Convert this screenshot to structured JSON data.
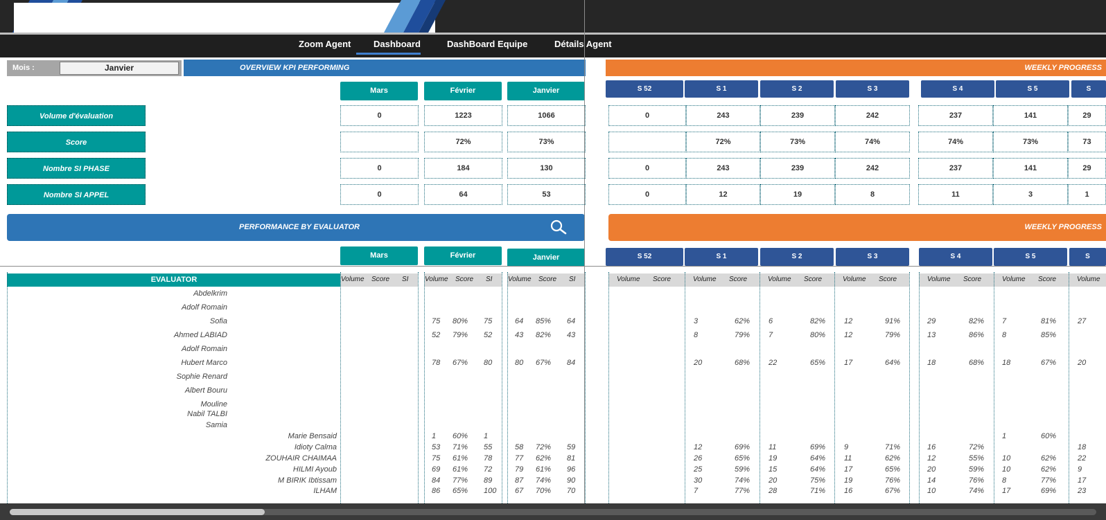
{
  "nav": {
    "items": [
      "Zoom Agent",
      "Dashboard",
      "DashBoard Equipe",
      "Détails Agent"
    ],
    "active": "Dashboard"
  },
  "filter": {
    "label": "Mois :",
    "value": "Janvier"
  },
  "overview": {
    "title": "OVERVIEW KPI PERFORMING",
    "months": [
      "Mars",
      "Février",
      "Janvier"
    ],
    "kpis": [
      {
        "label": "Volume d'évaluation",
        "values": [
          "0",
          "1223",
          "1066"
        ]
      },
      {
        "label": "Score",
        "values": [
          "",
          "72%",
          "73%"
        ]
      },
      {
        "label": "Nombre SI PHASE",
        "values": [
          "0",
          "184",
          "130"
        ]
      },
      {
        "label": "Nombre SI APPEL",
        "values": [
          "0",
          "64",
          "53"
        ]
      }
    ]
  },
  "weekly": {
    "title": "WEEKLY PROGRESS",
    "weeks": [
      "S 52",
      "S 1",
      "S 2",
      "S 3",
      "S 4",
      "S 5",
      "S"
    ],
    "kpis": [
      [
        "0",
        "243",
        "239",
        "242",
        "237",
        "141",
        "29"
      ],
      [
        "",
        "72%",
        "73%",
        "74%",
        "74%",
        "73%",
        "73"
      ],
      [
        "0",
        "243",
        "239",
        "242",
        "237",
        "141",
        "29"
      ],
      [
        "0",
        "12",
        "19",
        "8",
        "11",
        "3",
        "1"
      ]
    ]
  },
  "performance": {
    "title": "PERFORMANCE  BY EVALUATOR",
    "weekly_title": "WEEKLY PROGRESS",
    "evaluator_header": "EVALUATOR",
    "month_subcols": [
      "Volume",
      "Score",
      "SI"
    ],
    "week_subcols": [
      "Volume",
      "Score"
    ],
    "rows": [
      {
        "name": "Abdelkrim",
        "m": [
          "",
          "",
          "",
          "",
          "",
          "",
          "",
          "",
          ""
        ],
        "w": [
          "",
          "",
          "",
          "",
          "",
          "",
          "",
          "",
          "",
          "",
          "",
          "",
          ""
        ]
      },
      {
        "name": "Adolf Romain",
        "m": [
          "",
          "",
          "",
          "",
          "",
          "",
          "",
          "",
          ""
        ],
        "w": [
          "",
          "",
          "",
          "",
          "",
          "",
          "",
          "",
          "",
          "",
          "",
          "",
          ""
        ]
      },
      {
        "name": "Sofia",
        "m": [
          "",
          "",
          "",
          "75",
          "80%",
          "75",
          "64",
          "85%",
          "64"
        ],
        "w": [
          "",
          "",
          "3",
          "62%",
          "6",
          "82%",
          "12",
          "91%",
          "29",
          "82%",
          "7",
          "81%",
          "27"
        ]
      },
      {
        "name": "Ahmed LABIAD",
        "m": [
          "",
          "",
          "",
          "52",
          "79%",
          "52",
          "43",
          "82%",
          "43"
        ],
        "w": [
          "",
          "",
          "8",
          "79%",
          "7",
          "80%",
          "12",
          "79%",
          "13",
          "86%",
          "8",
          "85%",
          ""
        ]
      },
      {
        "name": "Adolf Romain",
        "m": [
          "",
          "",
          "",
          "",
          "",
          "",
          "",
          "",
          ""
        ],
        "w": [
          "",
          "",
          "",
          "",
          "",
          "",
          "",
          "",
          "",
          "",
          "",
          "",
          ""
        ]
      },
      {
        "name": "Hubert Marco",
        "m": [
          "",
          "",
          "",
          "78",
          "67%",
          "80",
          "80",
          "67%",
          "84"
        ],
        "w": [
          "",
          "",
          "20",
          "68%",
          "22",
          "65%",
          "17",
          "64%",
          "18",
          "68%",
          "18",
          "67%",
          "20"
        ]
      },
      {
        "name": "Sophie Renard",
        "m": [
          "",
          "",
          "",
          "",
          "",
          "",
          "",
          "",
          ""
        ],
        "w": [
          "",
          "",
          "",
          "",
          "",
          "",
          "",
          "",
          "",
          "",
          "",
          "",
          ""
        ]
      },
      {
        "name": "Albert Bouru",
        "m": [
          "",
          "",
          "",
          "",
          "",
          "",
          "",
          "",
          ""
        ],
        "w": [
          "",
          "",
          "",
          "",
          "",
          "",
          "",
          "",
          "",
          "",
          "",
          "",
          ""
        ]
      },
      {
        "name": "Mouline",
        "m": [
          "",
          "",
          "",
          "",
          "",
          "",
          "",
          "",
          ""
        ],
        "w": [
          "",
          "",
          "",
          "",
          "",
          "",
          "",
          "",
          "",
          "",
          "",
          "",
          ""
        ]
      },
      {
        "name": "Nabil TALBI",
        "m": [
          "",
          "",
          "",
          "",
          "",
          "",
          "",
          "",
          ""
        ],
        "w": [
          "",
          "",
          "",
          "",
          "",
          "",
          "",
          "",
          "",
          "",
          "",
          "",
          ""
        ]
      },
      {
        "name": "Samia",
        "m": [
          "",
          "",
          "",
          "",
          "",
          "",
          "",
          "",
          ""
        ],
        "w": [
          "",
          "",
          "",
          "",
          "",
          "",
          "",
          "",
          "",
          "",
          "",
          "",
          ""
        ]
      },
      {
        "name": "Marie Bensaid",
        "m": [
          "",
          "",
          "",
          "1",
          "60%",
          "1",
          "",
          "",
          ""
        ],
        "w": [
          "",
          "",
          "",
          "",
          "",
          "",
          "",
          "",
          "",
          "",
          "1",
          "60%",
          ""
        ]
      },
      {
        "name": "Idioty Calma",
        "m": [
          "",
          "",
          "",
          "53",
          "71%",
          "55",
          "58",
          "72%",
          "59"
        ],
        "w": [
          "",
          "",
          "12",
          "69%",
          "11",
          "69%",
          "9",
          "71%",
          "16",
          "72%",
          "",
          "",
          "18"
        ]
      },
      {
        "name": "ZOUHAIR CHAIMAA",
        "m": [
          "",
          "",
          "",
          "75",
          "61%",
          "78",
          "77",
          "62%",
          "81"
        ],
        "w": [
          "",
          "",
          "26",
          "65%",
          "19",
          "64%",
          "11",
          "62%",
          "12",
          "55%",
          "10",
          "62%",
          "22"
        ]
      },
      {
        "name": "HILMI Ayoub",
        "m": [
          "",
          "",
          "",
          "69",
          "61%",
          "72",
          "79",
          "61%",
          "96"
        ],
        "w": [
          "",
          "",
          "25",
          "59%",
          "15",
          "64%",
          "17",
          "65%",
          "20",
          "59%",
          "10",
          "62%",
          "9"
        ]
      },
      {
        "name": "M BIRIK Ibtissam",
        "m": [
          "",
          "",
          "",
          "84",
          "77%",
          "89",
          "87",
          "74%",
          "90"
        ],
        "w": [
          "",
          "",
          "30",
          "74%",
          "20",
          "75%",
          "19",
          "76%",
          "14",
          "76%",
          "8",
          "77%",
          "17"
        ]
      },
      {
        "name": "ILHAM",
        "m": [
          "",
          "",
          "",
          "86",
          "65%",
          "100",
          "67",
          "70%",
          "70"
        ],
        "w": [
          "",
          "",
          "7",
          "77%",
          "28",
          "71%",
          "16",
          "67%",
          "10",
          "74%",
          "17",
          "69%",
          "23"
        ]
      }
    ]
  }
}
